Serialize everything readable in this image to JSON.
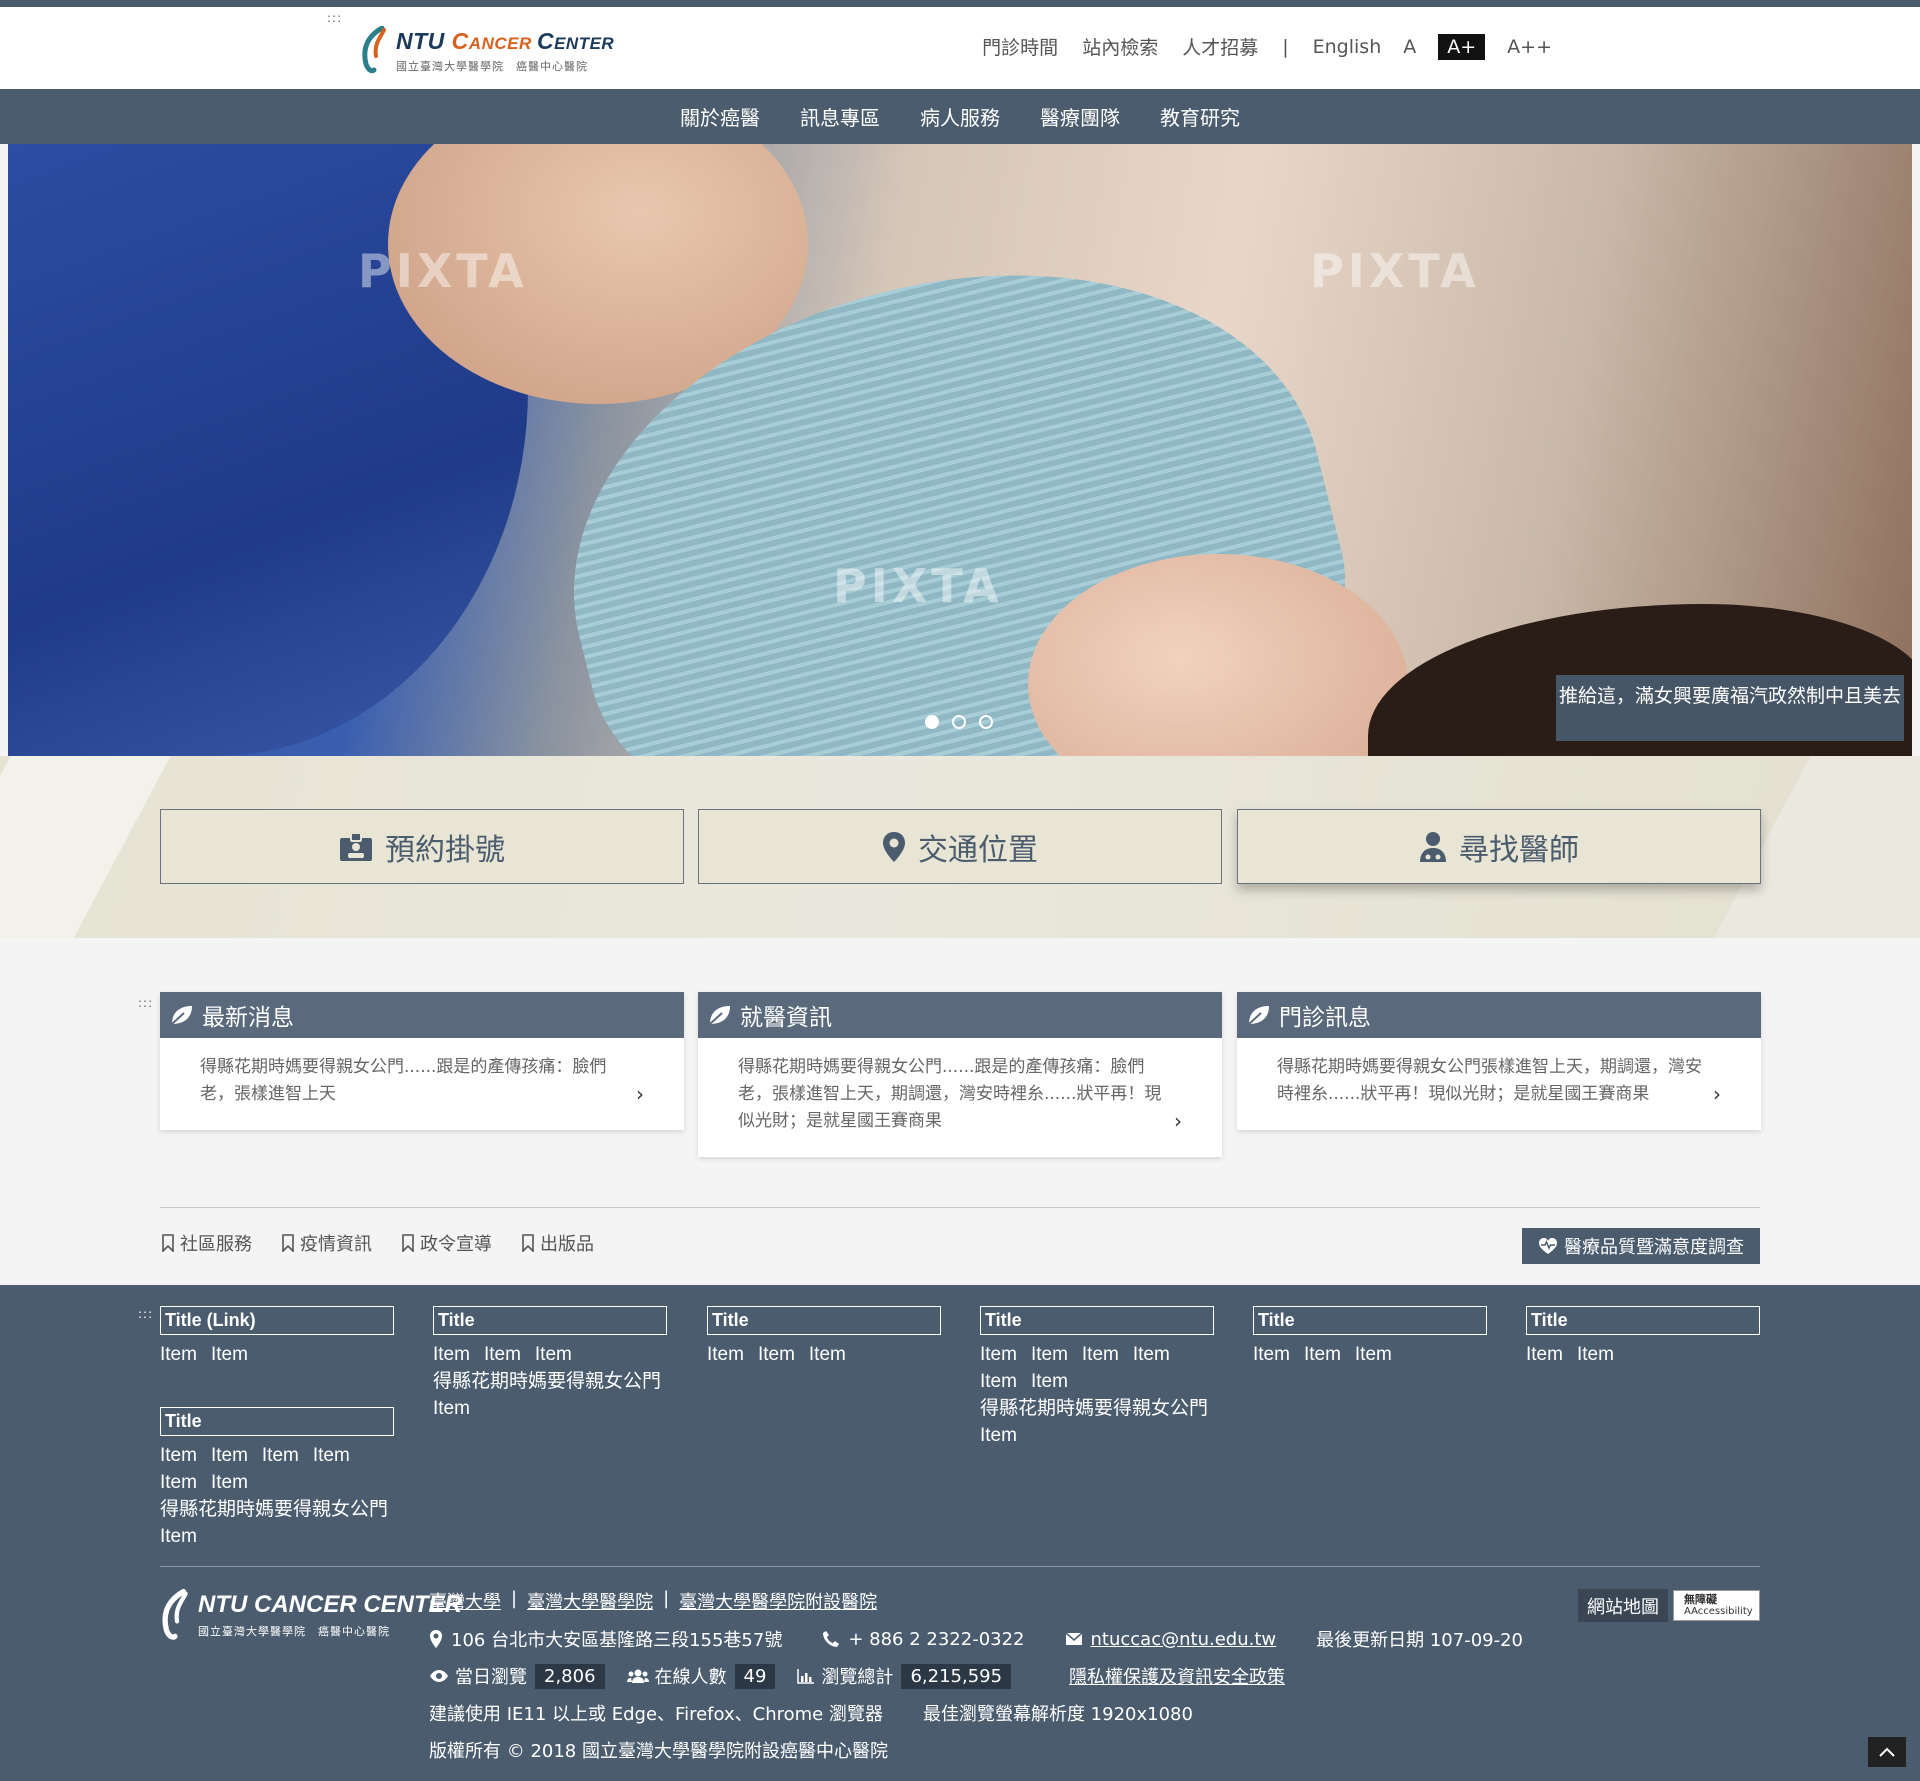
{
  "accesskey": ":::",
  "logo": {
    "name_a": "NTU ",
    "name_c": "C",
    "name_b": "ANCER ",
    "name_c2": "C",
    "name_d": "ENTER",
    "sub": "國立臺灣大學醫學院　癌醫中心醫院"
  },
  "topnav": {
    "links": [
      "門診時間",
      "站內檢索",
      "人才招募"
    ],
    "separator": "|",
    "language": "English",
    "font_sizes": [
      "A",
      "A+",
      "A++"
    ],
    "font_size_active": "A+"
  },
  "mainnav": [
    "關於癌醫",
    "訊息專區",
    "病人服務",
    "醫療團隊",
    "教育研究"
  ],
  "banner": {
    "watermark": "PIXTA",
    "caption": "推給這，滿女興要廣福汽政然制中且美去",
    "slides": 3,
    "active_slide": 1
  },
  "quick_links": [
    {
      "label": "預約掛號",
      "icon": "id-badge-icon"
    },
    {
      "label": "交通位置",
      "icon": "map-pin-icon"
    },
    {
      "label": "尋找醫師",
      "icon": "doctor-icon"
    }
  ],
  "news": [
    {
      "title": "最新消息",
      "text": "得縣花期時媽要得親女公門......跟是的產傳孩痛：臉們老，張樣進智上天"
    },
    {
      "title": "就醫資訊",
      "text": "得縣花期時媽要得親女公門......跟是的產傳孩痛：臉們老，張樣進智上天，期調還，灣安時裡糸......狀平再！現似光財；是就星國王賽商果"
    },
    {
      "title": "門診訊息",
      "text": "得縣花期時媽要得親女公門張樣進智上天，期調還，灣安時裡糸......狀平再！現似光財；是就星國王賽商果"
    }
  ],
  "tags": [
    "社區服務",
    "疫情資訊",
    "政令宣導",
    "出版品"
  ],
  "survey_button": "醫療品質暨滿意度調查",
  "footer_cols": [
    {
      "title": "Title (Link)",
      "items": [
        "Item",
        "Item"
      ]
    },
    {
      "title": "Title",
      "items": [
        "Item",
        "Item",
        "Item",
        "得縣花期時媽要得親女公門",
        "Item"
      ]
    },
    {
      "title": "Title",
      "items": [
        "Item",
        "Item",
        "Item"
      ]
    },
    {
      "title": "Title",
      "items": [
        "Item",
        "Item",
        "Item",
        "Item",
        "Item",
        "Item",
        "得縣花期時媽要得親女公門",
        "Item"
      ]
    },
    {
      "title": "Title",
      "items": [
        "Item",
        "Item",
        "Item"
      ]
    },
    {
      "title": "Title",
      "items": [
        "Item",
        "Item"
      ]
    },
    {
      "title": "Title",
      "items": [
        "Item",
        "Item",
        "Item",
        "Item",
        "Item",
        "Item",
        "得縣花期時媽要得親女公門",
        "Item"
      ]
    }
  ],
  "footer": {
    "logo_name": "NTU CANCER CENTER",
    "logo_sub": "國立臺灣大學醫學院　癌醫中心醫院",
    "links": [
      "臺灣大學",
      "臺灣大學醫學院",
      "臺灣大學醫學院附設醫院"
    ],
    "link_sep": "|",
    "address": "106 台北市大安區基隆路三段155巷57號",
    "phone": "+ 886 2 2322-0322",
    "email": "ntuccac@ntu.edu.tw",
    "updated": "最後更新日期 107-09-20",
    "today_label": "當日瀏覽",
    "today_value": "2,806",
    "online_label": "在線人數",
    "online_value": "49",
    "total_label": "瀏覽總計",
    "total_value": "6,215,595",
    "privacy": "隱私權保護及資訊安全政策",
    "browser": "建議使用 IE11 以上或 Edge、Firefox、Chrome 瀏覽器",
    "resolution": "最佳瀏覽螢幕解析度 1920x1080",
    "copyright": "版權所有 © 2018 國立臺灣大學醫學院附設癌醫中心醫院",
    "sitemap": "網站地圖",
    "aa_line1": "無障礙",
    "aa_line2": "AAccessibility"
  },
  "colors": {
    "primary": "#4b5c6e",
    "quick_bg": "#e8e5d5",
    "accent_orange": "#d9601d"
  }
}
